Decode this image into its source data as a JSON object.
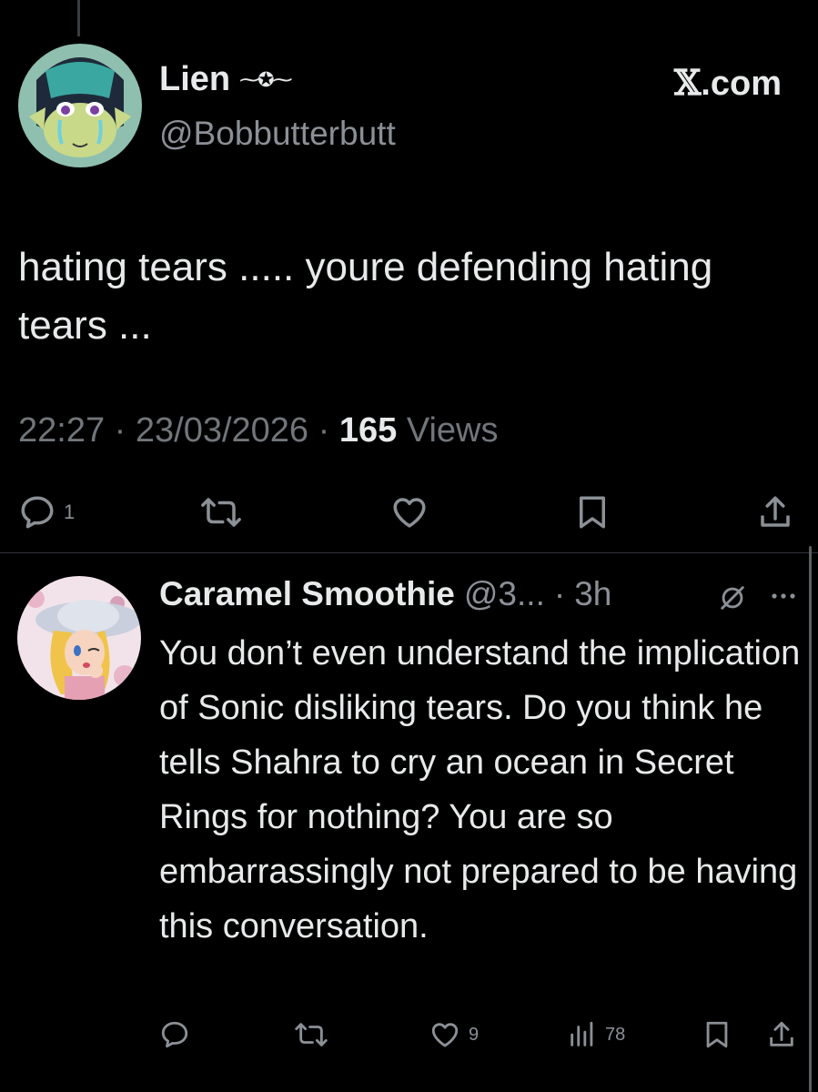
{
  "main_tweet": {
    "display_name": "Lien",
    "name_emoji": "⁓✪⁓",
    "handle": "@Bobbutterbutt",
    "source_logo": {
      "glyph": "𝕏",
      "text": ".com"
    },
    "text": "hating tears ..... youre defending hating tears ...",
    "meta": {
      "time": "22:27",
      "date": "23/03/2026",
      "separator": "·",
      "views_count": "165",
      "views_label": "Views"
    },
    "actions": {
      "reply_count": "1",
      "icons": [
        "reply-icon",
        "retweet-icon",
        "like-icon",
        "bookmark-icon",
        "share-icon"
      ]
    }
  },
  "reply_tweet": {
    "display_name": "Caramel Smoothie",
    "handle": "@3...",
    "separator": "·",
    "time": "3h",
    "text": "You don’t even understand the implication of Sonic disliking tears. Do you think he tells Shahra to cry an ocean in Secret Rings for nothing? You are so embarrassingly not prepared to be having this conversation.",
    "actions": {
      "like_count": "9",
      "views_count": "78",
      "icons": [
        "reply-icon",
        "retweet-icon",
        "like-icon",
        "views-icon",
        "bookmark-icon",
        "share-icon"
      ]
    }
  },
  "colors": {
    "background": "#000000",
    "text_primary": "#e7e9ea",
    "text_secondary": "#71767b",
    "divider": "#2f3336"
  }
}
